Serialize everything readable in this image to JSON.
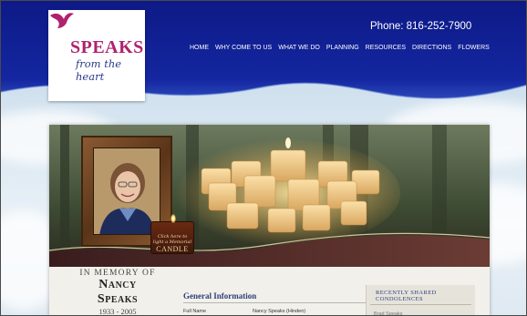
{
  "brand": {
    "name": "SPEAKS",
    "tagline": "from the heart",
    "bird_color": "#b0226e"
  },
  "header": {
    "phone": "Phone: 816-252-7900",
    "background": "#12208c"
  },
  "nav": {
    "items": [
      {
        "label": "HOME"
      },
      {
        "label": "WHY COME TO US"
      },
      {
        "label": "WHAT WE DO"
      },
      {
        "label": "PLANNING"
      },
      {
        "label": "RESOURCES"
      },
      {
        "label": "DIRECTIONS"
      },
      {
        "label": "FLOWERS"
      }
    ]
  },
  "candle_button": {
    "line1": "Click here to",
    "line2": "light a Memorial",
    "line3": "CANDLE"
  },
  "memorial": {
    "label": "In Memory of",
    "first_name": "Nancy",
    "last_name": "Speaks",
    "dates": "1933 - 2005"
  },
  "general_info": {
    "title": "General Information",
    "rows": [
      {
        "key": "Full Name",
        "value": "Nancy Speaks (Hinden)"
      }
    ]
  },
  "condolences": {
    "title": "Recently Shared Condolences",
    "entries": [
      "Brad Speaks"
    ]
  }
}
